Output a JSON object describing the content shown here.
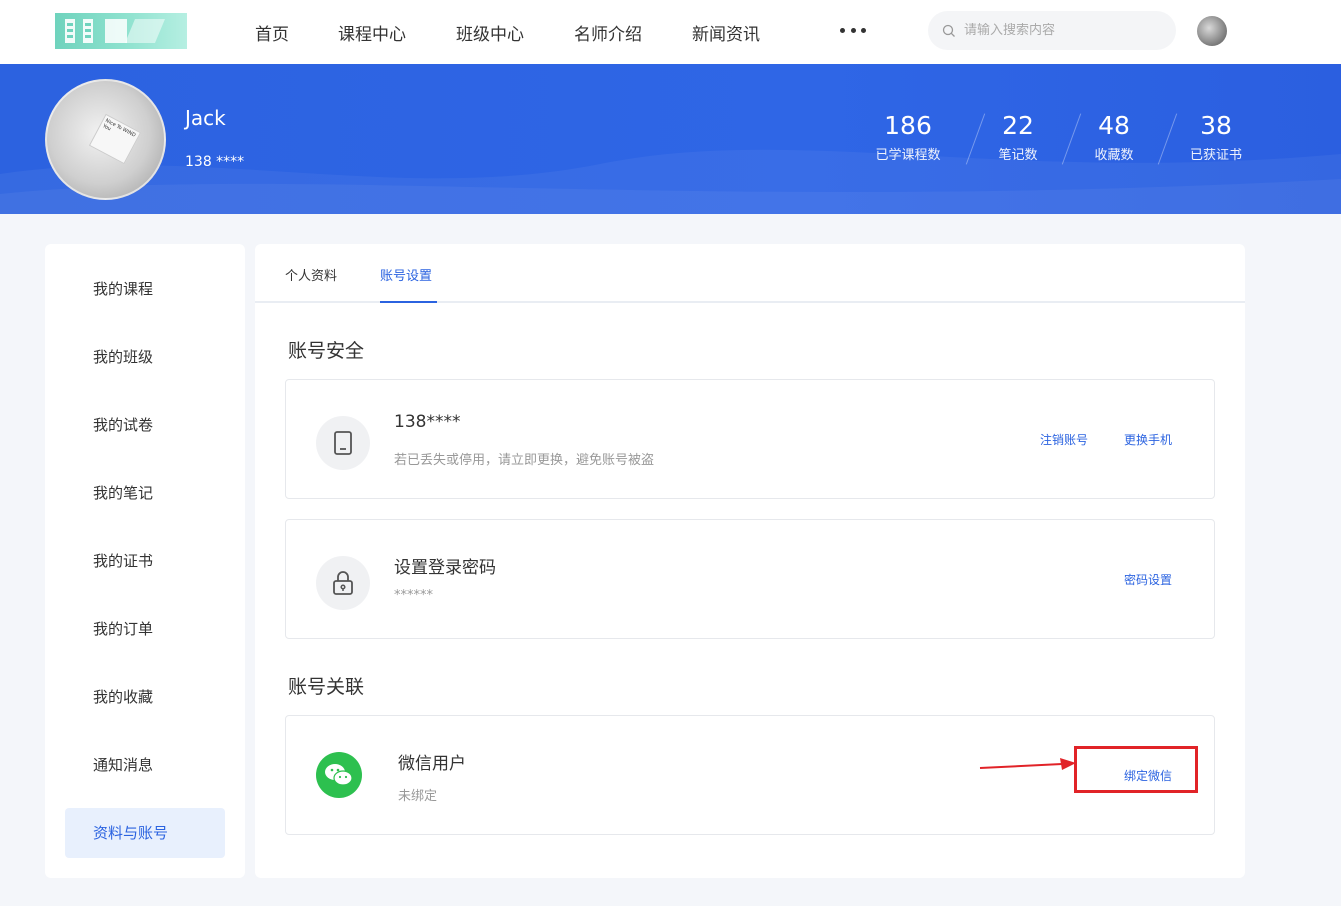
{
  "nav": {
    "items": [
      "首页",
      "课程中心",
      "班级中心",
      "名师介绍",
      "新闻资讯"
    ],
    "search_placeholder": "请输入搜索内容"
  },
  "profile": {
    "name": "Jack",
    "phone": "138 ****",
    "stats": [
      {
        "value": "186",
        "label": "已学课程数"
      },
      {
        "value": "22",
        "label": "笔记数"
      },
      {
        "value": "48",
        "label": "收藏数"
      },
      {
        "value": "38",
        "label": "已获证书"
      }
    ]
  },
  "sidebar": {
    "items": [
      "我的课程",
      "我的班级",
      "我的试卷",
      "我的笔记",
      "我的证书",
      "我的订单",
      "我的收藏",
      "通知消息",
      "资料与账号"
    ],
    "active_index": 8
  },
  "tabs": [
    "个人资料",
    "账号设置"
  ],
  "security": {
    "title": "账号安全",
    "phone_card": {
      "title": "138****",
      "subtitle": "若已丢失或停用，请立即更换，避免账号被盗",
      "link_cancel": "注销账号",
      "link_change": "更换手机"
    },
    "password_card": {
      "title": "设置登录密码",
      "subtitle": "******",
      "link": "密码设置"
    }
  },
  "linking": {
    "title": "账号关联",
    "wechat_card": {
      "title": "微信用户",
      "subtitle": "未绑定",
      "link": "绑定微信"
    }
  },
  "colors": {
    "brand_blue": "#2b63e0",
    "banner_blue": "#2f66e6",
    "wechat_green": "#2dc04f",
    "highlight_red": "#e12328"
  }
}
